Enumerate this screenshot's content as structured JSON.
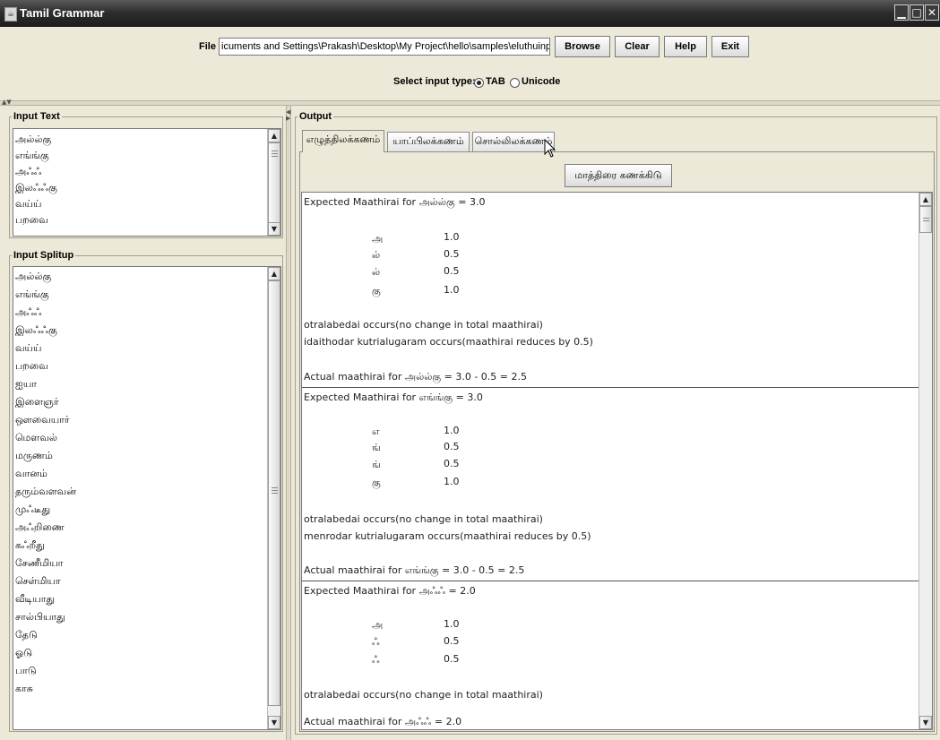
{
  "window": {
    "title": "Tamil Grammar",
    "app_icon": "java-cup-icon"
  },
  "top": {
    "file_label": "File",
    "file_path": "icuments and Settings\\Prakash\\Desktop\\My Project\\hello\\samples\\eluthuinput.txt",
    "buttons": {
      "browse": "Browse",
      "clear": "Clear",
      "help": "Help",
      "exit": "Exit"
    },
    "input_type_label": "Select input type:",
    "input_types": [
      {
        "label": "TAB",
        "selected": true
      },
      {
        "label": "Unicode",
        "selected": false
      }
    ]
  },
  "input_text": {
    "title": "Input Text",
    "items": [
      "அல்ல்கு",
      "எங்ங்கு",
      "அஃஃ",
      "இலஃஃகு",
      "வய்ய்",
      "பறவை"
    ]
  },
  "input_splitup": {
    "title": "Input Splitup",
    "items": [
      "அல்ல்கு",
      "எங்ங்கு",
      "அஃஃ",
      "இலஃஃகு",
      "வய்ய்",
      "பறவை",
      "ஐயா",
      "இளைஞர்",
      "ஔவையார்",
      "மௌவல்",
      "மருணம்",
      "வானம்",
      "தரும்வளவன்",
      "முஃடீது",
      "அஃறிணை",
      "கஃறீது",
      "சேணீமியா",
      "செள்மியா",
      "வீடியாது",
      "சால்பியாது",
      "தேடு",
      "ஓடு",
      "பாடு",
      "காசு"
    ]
  },
  "output": {
    "title": "Output",
    "tabs": [
      "எழுத்திலக்கணம்",
      "யாப்பிலக்கணம்",
      "சொல்லிலக்கணம்"
    ],
    "active_tab": 0,
    "calc_button": "மாத்திரை கணக்கிடு",
    "blocks": [
      {
        "expected": "Expected Maathirai for அல்ல்கு = 3.0",
        "rows": [
          {
            "letter": "அ",
            "value": "1.0"
          },
          {
            "letter": "ல்",
            "value": "0.5"
          },
          {
            "letter": "ல்",
            "value": "0.5"
          },
          {
            "letter": "கு",
            "value": "1.0"
          }
        ],
        "notes": [
          "otralabedai occurs(no change in total maathirai)",
          "idaithodar kutrialugaram occurs(maathirai reduces by 0.5)"
        ],
        "actual": "Actual maathirai for அல்ல்கு = 3.0 - 0.5 = 2.5"
      },
      {
        "expected": "Expected Maathirai for எங்ங்கு = 3.0",
        "rows": [
          {
            "letter": "எ",
            "value": "1.0"
          },
          {
            "letter": "ங்",
            "value": "0.5"
          },
          {
            "letter": "ங்",
            "value": "0.5"
          },
          {
            "letter": "கு",
            "value": "1.0"
          }
        ],
        "notes": [
          "otralabedai occurs(no change in total maathirai)",
          "menrodar kutrialugaram occurs(maathirai reduces by 0.5)"
        ],
        "actual": "Actual maathirai for எங்ங்கு = 3.0 - 0.5 = 2.5"
      },
      {
        "expected": "Expected Maathirai for அஃஃ = 2.0",
        "rows": [
          {
            "letter": "அ",
            "value": "1.0"
          },
          {
            "letter": "ஃ",
            "value": "0.5"
          },
          {
            "letter": "ஃ",
            "value": "0.5"
          }
        ],
        "notes": [
          "otralabedai occurs(no change in total maathirai)"
        ],
        "actual": "Actual maathirai for அஃஃ = 2.0"
      }
    ]
  }
}
